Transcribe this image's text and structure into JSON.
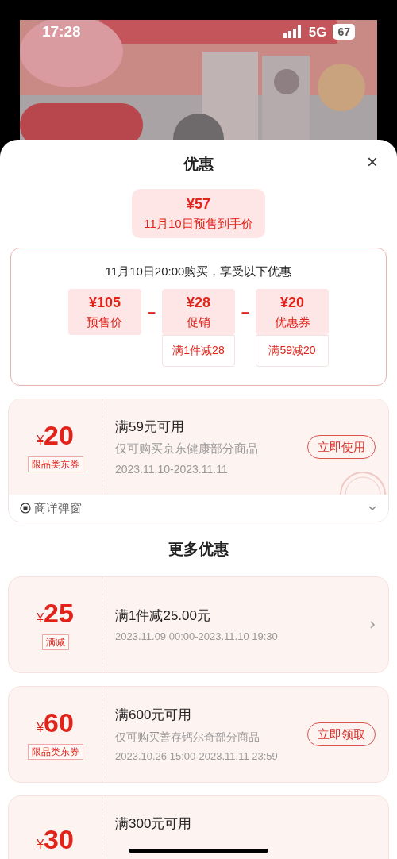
{
  "status_bar": {
    "time": "17:28",
    "network": "5G",
    "battery": "67"
  },
  "sheet": {
    "title": "优惠",
    "close": "×"
  },
  "summary": {
    "price": "¥57",
    "label": "11月10日预售到手价"
  },
  "breakdown": {
    "heading": "11月10日20:00购买，享受以下优惠",
    "items": [
      {
        "amount": "¥105",
        "label": "预售价"
      },
      {
        "operator": "–",
        "amount": "¥28",
        "label": "促销",
        "note": "满1件减28"
      },
      {
        "operator": "–",
        "amount": "¥20",
        "label": "优惠券",
        "note": "满59减20"
      }
    ]
  },
  "coupon": {
    "currency": "¥",
    "amount": "20",
    "tag": "限品类东券",
    "title": "满59元可用",
    "description": "仅可购买京东健康部分商品",
    "date": "2023.11.10-2023.11.11",
    "action": "立即使用",
    "footer": "商详弹窗"
  },
  "more_title": "更多优惠",
  "more_coupons": [
    {
      "kind": "arrow",
      "currency": "¥",
      "amount": "25",
      "tag": "满减",
      "title": "满1件减25.00元",
      "date": "2023.11.09 00:00-2023.11.10 19:30"
    },
    {
      "kind": "button",
      "currency": "¥",
      "amount": "60",
      "tag": "限品类东券",
      "title": "满600元可用",
      "description": "仅可购买善存钙尔奇部分商品",
      "date": "2023.10.26 15:00-2023.11.11 23:59",
      "action": "立即领取"
    },
    {
      "kind": "partial",
      "currency": "¥",
      "amount": "30",
      "title": "满300元可用"
    }
  ]
}
